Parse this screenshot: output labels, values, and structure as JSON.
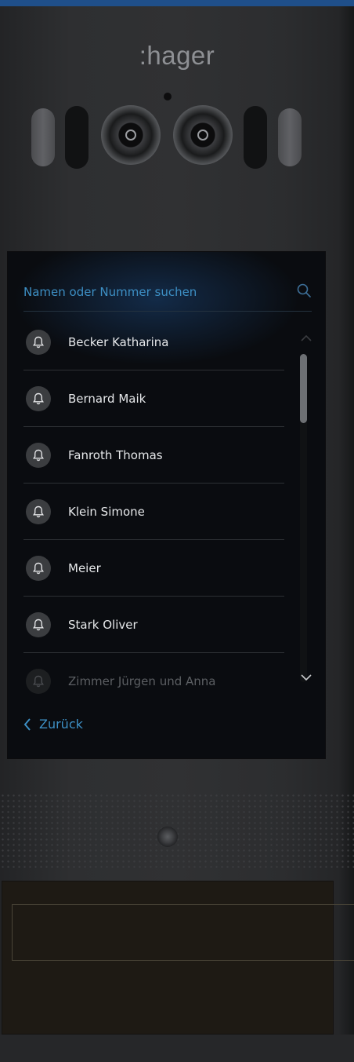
{
  "brand": {
    "logo_text": ":hager"
  },
  "search": {
    "placeholder": "Namen oder Nummer suchen",
    "icon": "search-icon"
  },
  "contacts": [
    {
      "name": "Becker Katharina"
    },
    {
      "name": "Bernard Maik"
    },
    {
      "name": "Fanroth Thomas"
    },
    {
      "name": "Klein Simone"
    },
    {
      "name": "Meier"
    },
    {
      "name": "Stark Oliver"
    },
    {
      "name": "Zimmer Jürgen und Anna"
    }
  ],
  "scroll": {
    "position_fraction": 0.0,
    "visible_fraction": 0.21
  },
  "nav": {
    "back_label": "Zurück"
  },
  "colors": {
    "accent": "#3d8fc4",
    "top_band": "#1f4f8a",
    "screen_bg": "#0a0c10"
  }
}
